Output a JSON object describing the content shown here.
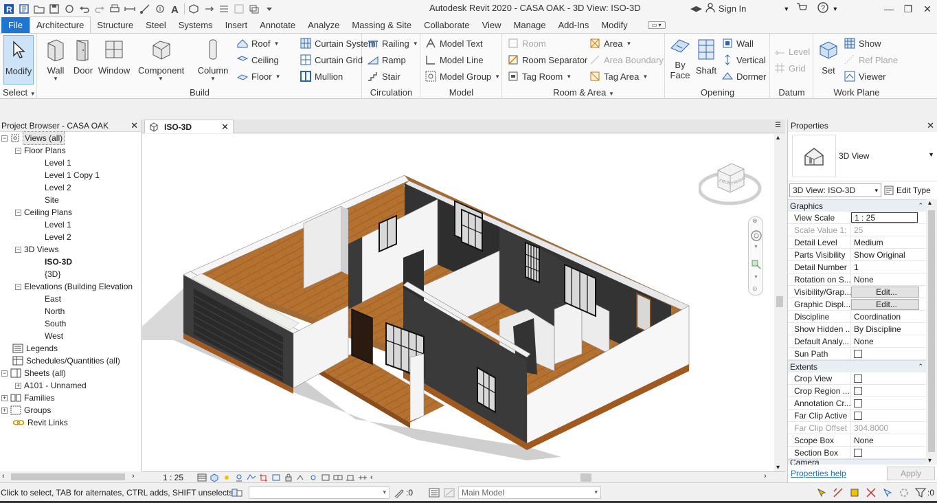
{
  "title_bar": {
    "app_title": "Autodesk Revit 2020 - CASA OAK - 3D View: ISO-3D",
    "signin_label": "Sign In",
    "qat_icons": [
      "revit-logo-icon",
      "open-icon",
      "save-icon",
      "sync-icon",
      "undo-icon",
      "redo-icon",
      "print-icon",
      "measure-icon",
      "dimension-icon",
      "tag-icon",
      "text-icon",
      "3d-view-icon",
      "section-icon",
      "thin-lines-icon",
      "close-hidden-icon",
      "switch-windows-icon",
      "customize-icon"
    ]
  },
  "ribbon": {
    "tabs": [
      "File",
      "Architecture",
      "Structure",
      "Steel",
      "Systems",
      "Insert",
      "Annotate",
      "Analyze",
      "Massing & Site",
      "Collaborate",
      "View",
      "Manage",
      "Add-Ins",
      "Modify"
    ],
    "active_tab": "Architecture",
    "select": {
      "modify": "Modify",
      "panel": "Select"
    },
    "build": {
      "panel": "Build",
      "wall": "Wall",
      "door": "Door",
      "window": "Window",
      "component": "Component",
      "column": "Column",
      "roof": "Roof",
      "ceiling": "Ceiling",
      "floor": "Floor",
      "curtain_system": "Curtain System",
      "curtain_grid": "Curtain Grid",
      "mullion": "Mullion"
    },
    "circulation": {
      "panel": "Circulation",
      "railing": "Railing",
      "ramp": "Ramp",
      "stair": "Stair"
    },
    "model": {
      "panel": "Model",
      "model_text": "Model Text",
      "model_line": "Model Line",
      "model_group": "Model Group"
    },
    "room_area": {
      "panel": "Room & Area",
      "room": "Room",
      "room_separator": "Room Separator",
      "tag_room": "Tag Room",
      "area": "Area",
      "area_boundary": "Area Boundary",
      "tag_area": "Tag Area"
    },
    "opening": {
      "panel": "Opening",
      "by_face_1": "By",
      "by_face_2": "Face",
      "shaft": "Shaft",
      "wall": "Wall",
      "vertical": "Vertical",
      "dormer": "Dormer"
    },
    "datum": {
      "panel": "Datum",
      "level": "Level",
      "grid": "Grid"
    },
    "work_plane": {
      "panel": "Work Plane",
      "set": "Set",
      "show": "Show",
      "ref_plane": "Ref Plane",
      "viewer": "Viewer"
    }
  },
  "project_browser": {
    "title": "Project Browser - CASA OAK",
    "nodes": [
      {
        "label": "Views (all)"
      },
      {
        "label": "Floor Plans"
      },
      {
        "label": "Level 1"
      },
      {
        "label": "Level 1 Copy 1"
      },
      {
        "label": "Level 2"
      },
      {
        "label": "Site"
      },
      {
        "label": "Ceiling Plans"
      },
      {
        "label": "Level 1"
      },
      {
        "label": "Level 2"
      },
      {
        "label": "3D Views"
      },
      {
        "label": "ISO-3D"
      },
      {
        "label": "{3D}"
      },
      {
        "label": "Elevations (Building Elevation"
      },
      {
        "label": "East"
      },
      {
        "label": "North"
      },
      {
        "label": "South"
      },
      {
        "label": "West"
      },
      {
        "label": "Legends"
      },
      {
        "label": "Schedules/Quantities (all)"
      },
      {
        "label": "Sheets (all)"
      },
      {
        "label": "A101 - Unnamed"
      },
      {
        "label": "Families"
      },
      {
        "label": "Groups"
      },
      {
        "label": "Revit Links"
      }
    ]
  },
  "view": {
    "tab_label": "ISO-3D",
    "scale": "1 : 25",
    "viewcube": {
      "front": "FRONT",
      "right": "RIGHT"
    }
  },
  "properties": {
    "title": "Properties",
    "type_name": "3D View",
    "selector": "3D View: ISO-3D",
    "edit_type": "Edit Type",
    "groups": {
      "graphics": "Graphics",
      "extents": "Extents",
      "camera": "Camera"
    },
    "graphics_rows": [
      {
        "name": "View Scale",
        "value": "1 : 25"
      },
      {
        "name": "Scale Value    1:",
        "value": "25"
      },
      {
        "name": "Detail Level",
        "value": "Medium"
      },
      {
        "name": "Parts Visibility",
        "value": "Show Original"
      },
      {
        "name": "Detail Number",
        "value": "1"
      },
      {
        "name": "Rotation on S...",
        "value": "None"
      },
      {
        "name": "Visibility/Grap...",
        "value": "Edit..."
      },
      {
        "name": "Graphic Displ...",
        "value": "Edit..."
      },
      {
        "name": "Discipline",
        "value": "Coordination"
      },
      {
        "name": "Show Hidden ...",
        "value": "By Discipline"
      },
      {
        "name": "Default Analy...",
        "value": "None"
      },
      {
        "name": "Sun Path",
        "value": ""
      }
    ],
    "extents_rows": [
      {
        "name": "Crop View",
        "value": ""
      },
      {
        "name": "Crop Region ...",
        "value": ""
      },
      {
        "name": "Annotation Cr...",
        "value": ""
      },
      {
        "name": "Far Clip Active",
        "value": ""
      },
      {
        "name": "Far Clip Offset",
        "value": "304.8000"
      },
      {
        "name": "Scope Box",
        "value": "None"
      },
      {
        "name": "Section Box",
        "value": ""
      }
    ],
    "help": "Properties help",
    "apply": "Apply"
  },
  "status": {
    "message": "Click to select, TAB for alternates, CTRL adds, SHIFT unselects.",
    "worksets_count": ":0",
    "model": "Main Model",
    "filter_count": ":0"
  },
  "colors": {
    "accent": "#1e76d2",
    "wall_dark": "#3a3a3a",
    "wall_light": "#f2f2f2",
    "floor_wood": "#b06a2c"
  }
}
